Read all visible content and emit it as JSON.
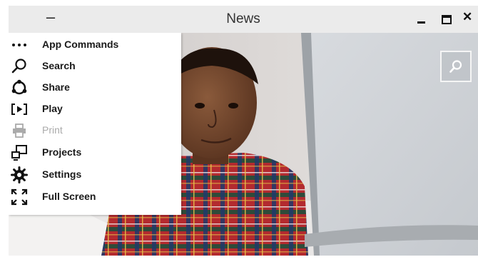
{
  "window": {
    "title": "News",
    "app_menu_icon": "dash-icon",
    "controls": [
      {
        "name": "minimize-icon"
      },
      {
        "name": "maximize-icon"
      },
      {
        "name": "close-icon",
        "glyph": "✕"
      }
    ]
  },
  "app_bar_menu": {
    "items": [
      {
        "label": "App Commands",
        "icon": "more-dots-icon",
        "enabled": true
      },
      {
        "label": "Search",
        "icon": "search-icon",
        "enabled": true
      },
      {
        "label": "Share",
        "icon": "share-icon",
        "enabled": true
      },
      {
        "label": "Play",
        "icon": "play-icon",
        "enabled": true
      },
      {
        "label": "Print",
        "icon": "print-icon",
        "enabled": false
      },
      {
        "label": "Projects",
        "icon": "projects-icon",
        "enabled": true
      },
      {
        "label": "Settings",
        "icon": "gear-icon",
        "enabled": true
      },
      {
        "label": "Full Screen",
        "icon": "fullscreen-icon",
        "enabled": true
      }
    ]
  },
  "content": {
    "image": "photo of a boy in a plaid shirt looking at a laptop",
    "search_button_icon": "search-icon"
  },
  "colors": {
    "titlebar": "#ebebeb",
    "menu_bg": "#ffffff",
    "text": "#1a1a1a",
    "disabled_text": "#aaaaaa"
  }
}
